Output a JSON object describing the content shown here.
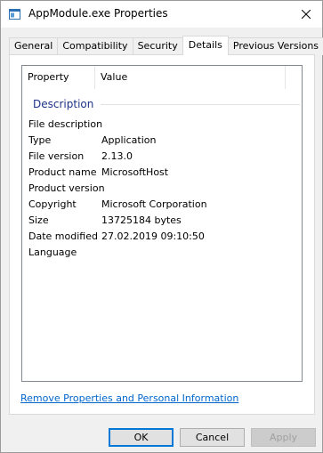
{
  "window": {
    "title": "AppModule.exe Properties",
    "close_glyph": "✕"
  },
  "tabs": [
    {
      "label": "General"
    },
    {
      "label": "Compatibility"
    },
    {
      "label": "Security"
    },
    {
      "label": "Details",
      "active": true
    },
    {
      "label": "Previous Versions"
    }
  ],
  "details": {
    "columns": {
      "property": "Property",
      "value": "Value"
    },
    "group": "Description",
    "rows": [
      {
        "property": "File description",
        "value": ""
      },
      {
        "property": "Type",
        "value": "Application"
      },
      {
        "property": "File version",
        "value": "2.13.0"
      },
      {
        "property": "Product name",
        "value": "MicrosoftHost"
      },
      {
        "property": "Product version",
        "value": ""
      },
      {
        "property": "Copyright",
        "value": "Microsoft Corporation"
      },
      {
        "property": "Size",
        "value": "13725184 bytes"
      },
      {
        "property": "Date modified",
        "value": "27.02.2019 09:10:50"
      },
      {
        "property": "Language",
        "value": ""
      }
    ]
  },
  "link": "Remove Properties and Personal Information",
  "buttons": {
    "ok": "OK",
    "cancel": "Cancel",
    "apply": "Apply"
  },
  "colors": {
    "accent": "#0078d7",
    "group_text": "#1e3287",
    "link": "#0066cc"
  }
}
